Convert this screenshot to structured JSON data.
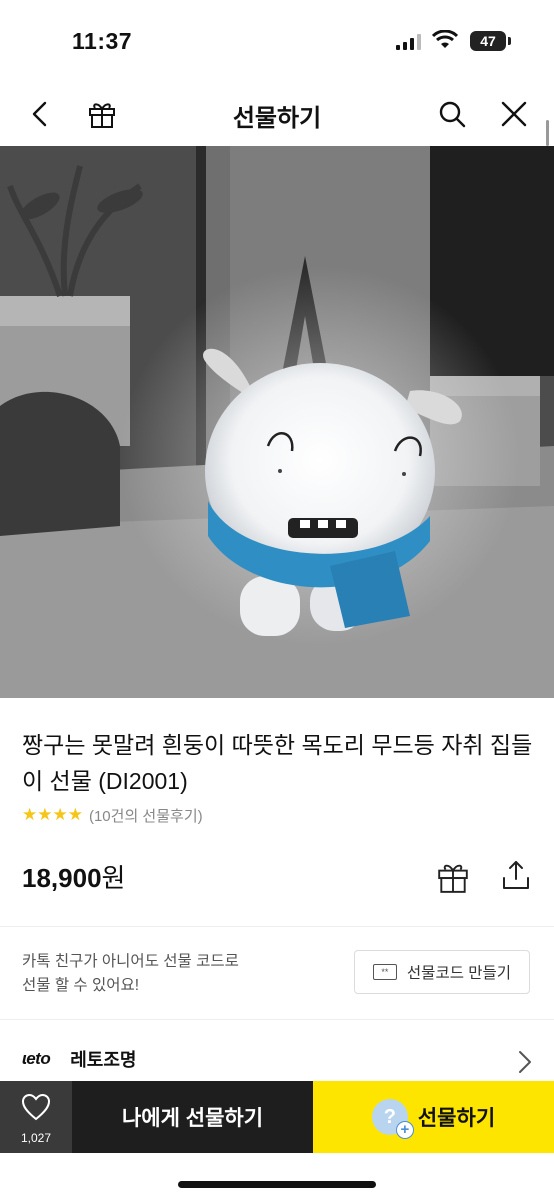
{
  "status_bar": {
    "time": "11:37",
    "battery": "47"
  },
  "nav": {
    "title": "선물하기",
    "back_icon": "chevron-left-icon",
    "gift_icon": "gift-icon",
    "search_icon": "search-icon",
    "close_icon": "close-icon"
  },
  "product": {
    "title": "짱구는 못말려 흰둥이 따뜻한 목도리 무드등 자취 집들이 선물 (DI2001)",
    "stars": "★★★★",
    "review_count": "(10건의 선물후기)",
    "price": "18,900",
    "currency": "원"
  },
  "promo": {
    "text_line1": "카톡 친구가 아니어도 선물 코드로",
    "text_line2": "선물 할 수 있어요!",
    "code_button": "선물코드 만들기"
  },
  "brand": {
    "logo": "ɩeto",
    "name": "레토조명"
  },
  "bottom_bar": {
    "like_count": "1,027",
    "self_gift_label": "나에게 선물하기",
    "gift_label": "선물하기"
  },
  "colors": {
    "accent": "#fee500",
    "dark": "#1e1e1e",
    "star": "#f5c518"
  }
}
